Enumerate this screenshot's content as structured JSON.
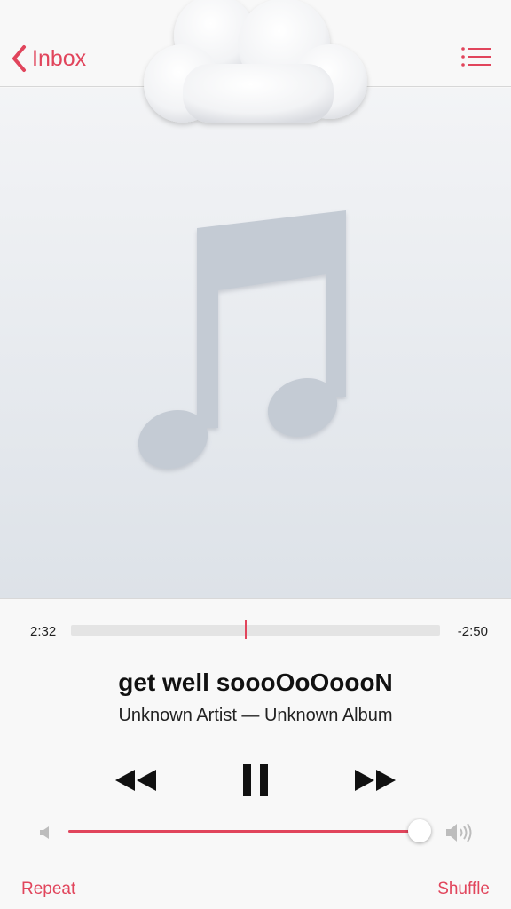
{
  "nav": {
    "back_label": "Inbox",
    "back_icon": "chevron-left-icon",
    "queue_icon": "list-icon"
  },
  "artwork": {
    "icon": "music-note-icon",
    "overlay": "cloud-emoji"
  },
  "player": {
    "elapsed": "2:32",
    "remaining": "-2:50",
    "progress": 0.47,
    "title": "get well soooOoOoooN",
    "subtitle": "Unknown Artist — Unknown Album"
  },
  "transport": {
    "rewind_icon": "rewind-icon",
    "pause_icon": "pause-icon",
    "forward_icon": "fast-forward-icon"
  },
  "volume": {
    "level": 0.999,
    "low_icon": "volume-low-icon",
    "high_icon": "volume-high-icon"
  },
  "footer": {
    "repeat_label": "Repeat",
    "shuffle_label": "Shuffle"
  },
  "colors": {
    "accent": "#e1455c",
    "background": "#f8f8f8",
    "note": "#c4cbd4"
  }
}
